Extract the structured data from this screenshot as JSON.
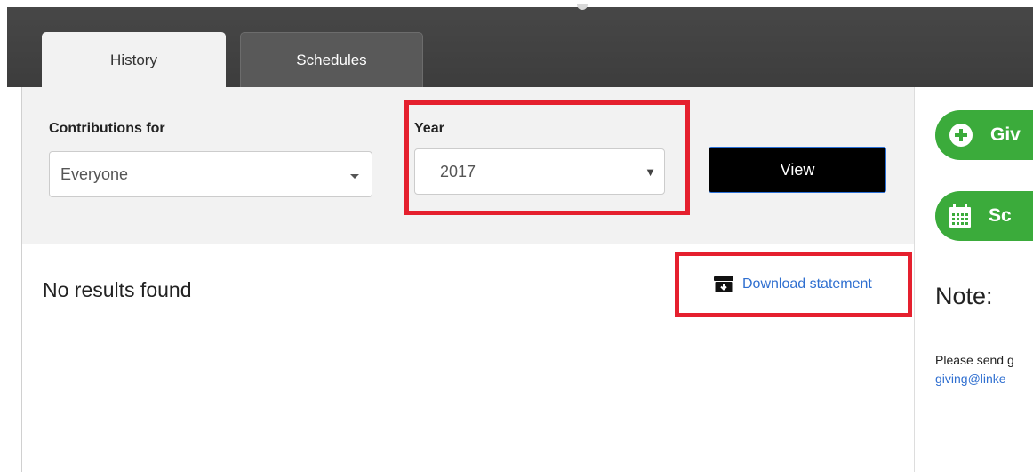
{
  "tabs": {
    "history_label": "History",
    "schedules_label": "Schedules"
  },
  "filters": {
    "contributions_label": "Contributions for",
    "contributions_value": "Everyone",
    "year_label": "Year",
    "year_value": "2017",
    "view_label": "View"
  },
  "results": {
    "empty_message": "No results found",
    "download_label": "Download statement"
  },
  "sidebar": {
    "give_label": "Giv",
    "schedule_label": "Sc",
    "note_title": "Note:",
    "note_text": "Please send g",
    "note_email": "giving@linke"
  },
  "colors": {
    "accent_green": "#3bab3b",
    "highlight_red": "#e5202e",
    "link_blue": "#2f6fd0"
  },
  "icons": [
    "plus-circle-icon",
    "calendar-icon",
    "archive-download-icon",
    "chevron-down-icon",
    "caret-down-icon"
  ]
}
